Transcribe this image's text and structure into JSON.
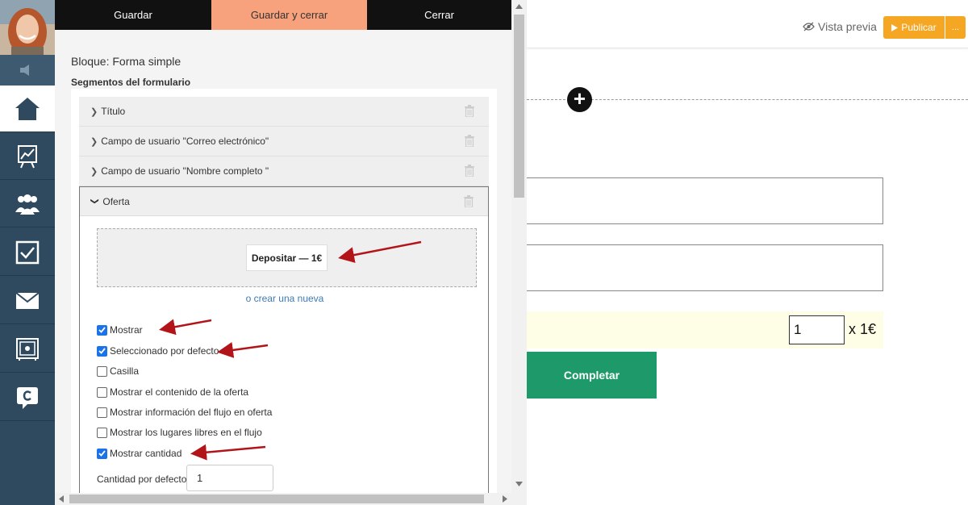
{
  "toolbar": {
    "save": "Guardar",
    "save_close": "Guardar y cerrar",
    "close": "Cerrar"
  },
  "editor": {
    "block_title": "Bloque: Forma simple",
    "segments_title": "Segmentos del formulario",
    "segments": [
      {
        "label": "Título"
      },
      {
        "label": "Campo de usuario \"Correo electrónico\""
      },
      {
        "label": "Campo de usuario \"Nombre completo \""
      },
      {
        "label": "Oferta"
      }
    ],
    "offer": {
      "chip": "Depositar — 1€",
      "create_link": "o crear una nueva",
      "options": [
        {
          "label": "Mostrar",
          "checked": true
        },
        {
          "label": "Seleccionado por defecto",
          "checked": true
        },
        {
          "label": "Casilla",
          "checked": false
        },
        {
          "label": "Mostrar el contenido de la oferta",
          "checked": false
        },
        {
          "label": "Mostrar información del flujo en oferta",
          "checked": false
        },
        {
          "label": "Mostrar los lugares libres en el flujo",
          "checked": false
        },
        {
          "label": "Mostrar cantidad",
          "checked": true
        }
      ],
      "qty_label": "Cantidad por defecto",
      "qty_value": "1"
    }
  },
  "canvas": {
    "preview": "Vista previa",
    "publish": "Publicar",
    "publish_more": "...",
    "quantity": "1",
    "price": "x 1€",
    "complete": "Completar"
  },
  "colors": {
    "accent_orange": "#f7a27c",
    "publish": "#f5a623",
    "complete": "#1e9a6a",
    "nav": "#2f4a5f",
    "arrow": "#b3141a"
  }
}
